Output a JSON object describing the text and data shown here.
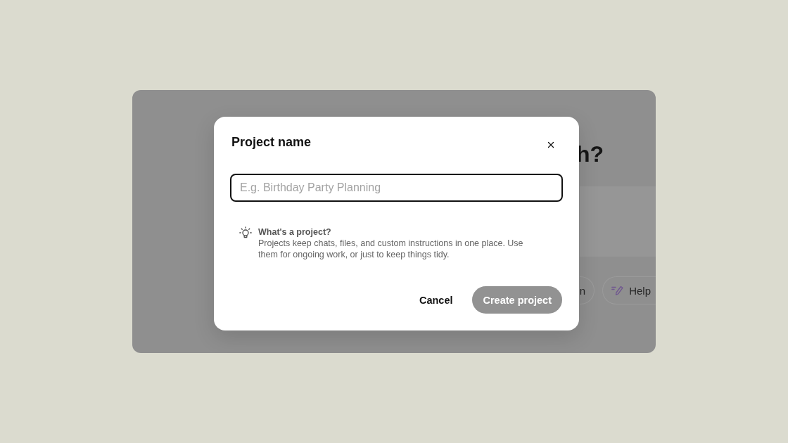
{
  "background_window": {
    "heading": "h?",
    "chips": [
      {
        "label": "n",
        "kind": "text"
      },
      {
        "label": "Help",
        "kind": "icon"
      }
    ]
  },
  "dialog": {
    "title": "Project name",
    "name_field": {
      "placeholder": "E.g. Birthday Party Planning"
    },
    "info": {
      "title": "What's a project?",
      "text": "Projects keep chats, files, and custom instructions in one place. Use them for ongoing work, or just to keep things tidy."
    },
    "buttons": [
      {
        "label": "Cancel",
        "kind": "secondary",
        "disabled": false
      },
      {
        "label": "Create project",
        "kind": "primary",
        "disabled": true
      }
    ]
  }
}
